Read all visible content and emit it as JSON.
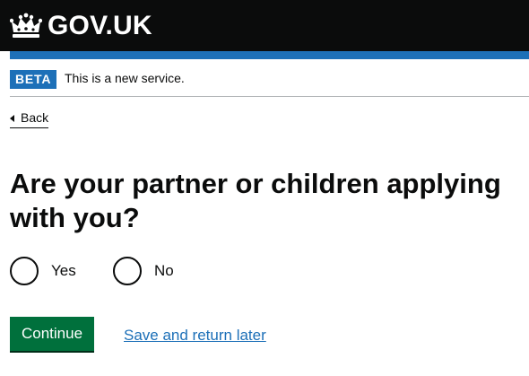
{
  "header": {
    "logo_text": "GOV.UK",
    "crown_icon": "crown-icon",
    "background": "#0b0c0c",
    "accent": "#1d70b8"
  },
  "phase_banner": {
    "tag": "BETA",
    "text": "This is a new service."
  },
  "back_link": {
    "label": "Back",
    "icon": "triangle-left-icon"
  },
  "question": {
    "heading": "Are your partner or children applying with you?",
    "options": [
      {
        "label": "Yes",
        "selected": false
      },
      {
        "label": "No",
        "selected": false
      }
    ]
  },
  "actions": {
    "continue_label": "Continue",
    "continue_color": "#00703c",
    "save_link_label": "Save and return later",
    "link_color": "#1d70b8"
  }
}
